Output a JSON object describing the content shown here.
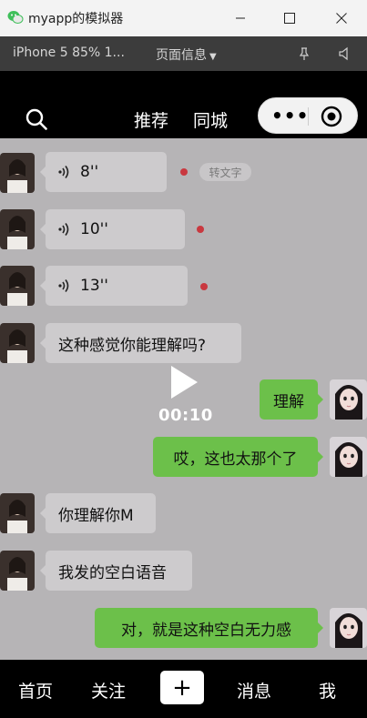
{
  "window": {
    "title": "myapp的模拟器",
    "logo_icon": "wechat-devtools-logo-icon",
    "minimize_icon": "minimize-icon",
    "maximize_icon": "maximize-icon",
    "close_icon": "close-icon"
  },
  "simulator": {
    "device_label": "iPhone 5 85% 1...",
    "page_info_label": "页面信息",
    "pin_icon": "pin-icon",
    "sound_icon": "speaker-icon"
  },
  "topbar": {
    "search_icon": "search-icon",
    "tabs": [
      "推荐",
      "同城"
    ],
    "capsule": {
      "more_icon": "more-dots-icon",
      "close_icon": "record-circle-icon"
    }
  },
  "chat": {
    "background": "#b6b4b6",
    "incoming_bubble_color": "#cdcbcd",
    "outgoing_bubble_color": "#6cc04a",
    "unread_dot_color": "#c9383f",
    "messages": [
      {
        "side": "left",
        "type": "voice",
        "text": "8''",
        "unread": true,
        "to_text": "转文字"
      },
      {
        "side": "left",
        "type": "voice",
        "text": "10''",
        "unread": true
      },
      {
        "side": "left",
        "type": "voice",
        "text": "13''",
        "unread": true
      },
      {
        "side": "left",
        "type": "text",
        "text": "这种感觉你能理解吗?"
      },
      {
        "side": "right",
        "type": "text",
        "text": "理解"
      },
      {
        "side": "right",
        "type": "text",
        "text": "哎，这也太那个了"
      },
      {
        "side": "left",
        "type": "text",
        "text": "你理解你M"
      },
      {
        "side": "left",
        "type": "text",
        "text": "我发的空白语音"
      },
      {
        "side": "right",
        "type": "text",
        "text": "对，就是这种空白无力感"
      }
    ],
    "video": {
      "play_icon": "play-icon",
      "time": "00:10"
    }
  },
  "bottomnav": {
    "items": [
      "首页",
      "关注",
      "+",
      "消息",
      "我"
    ]
  }
}
